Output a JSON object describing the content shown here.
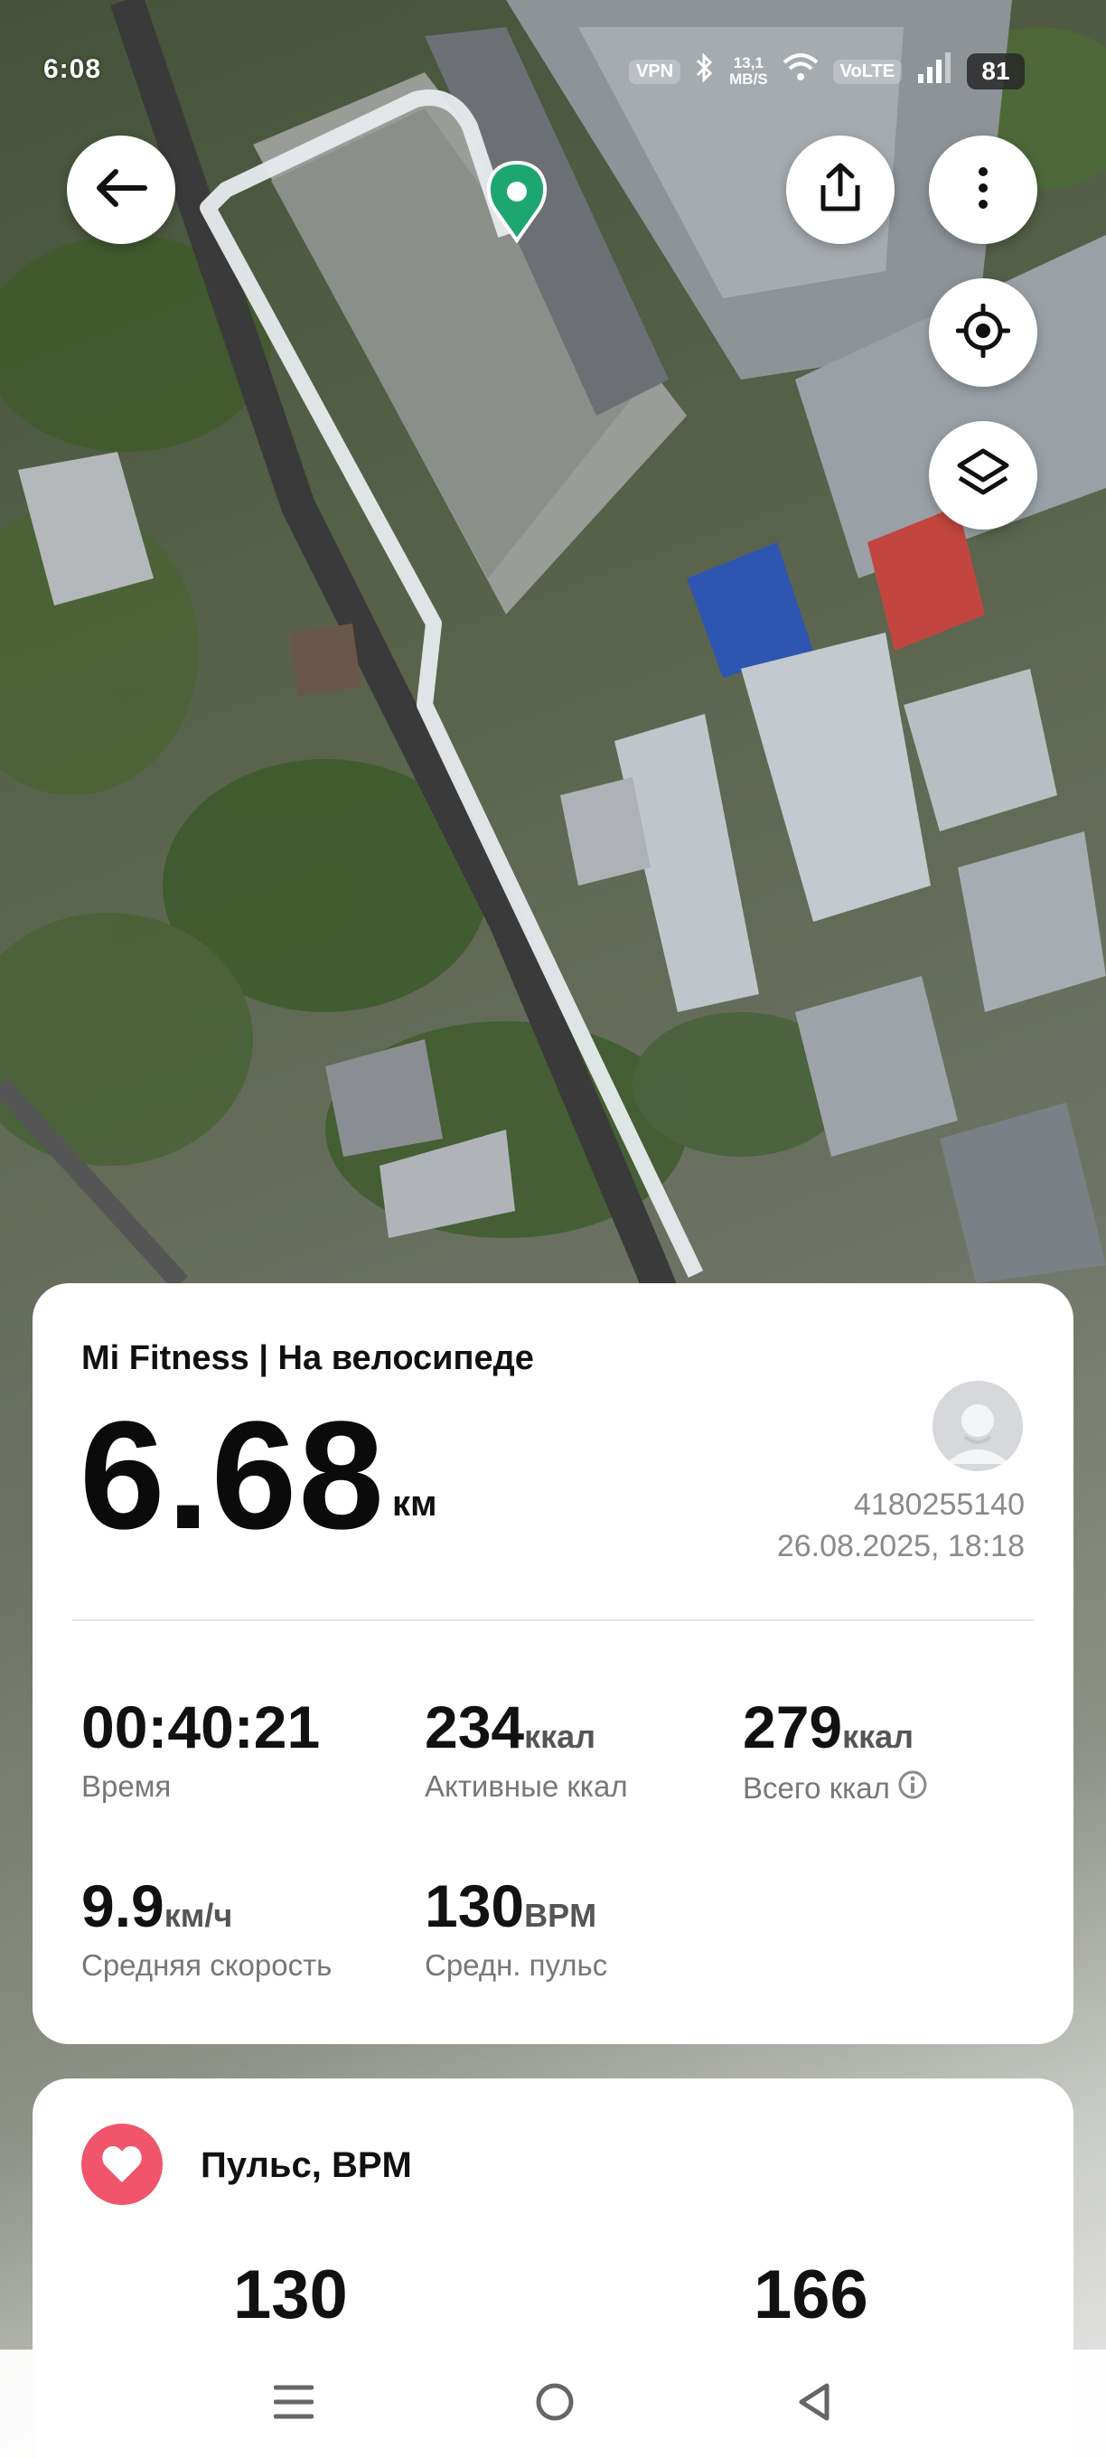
{
  "status_bar": {
    "time": "6:08",
    "vpn": "VPN",
    "net_speed_value": "13,1",
    "net_speed_unit": "MB/S",
    "volte": "VoLTE",
    "battery": "81"
  },
  "map": {
    "back_icon": "arrow-left-icon",
    "share_icon": "share-icon",
    "more_icon": "more-vertical-icon",
    "locate_icon": "crosshair-icon",
    "layers_icon": "layers-icon",
    "pin_color": "#1ea672",
    "route_color": "#e8ebee"
  },
  "summary": {
    "title": "Mi Fitness | На велосипеде",
    "distance": "6.68",
    "distance_unit": "км",
    "user_id": "4180255140",
    "datetime": "26.08.2025, 18:18",
    "stats": {
      "time": {
        "value": "00:40:21",
        "label": "Время"
      },
      "active_kcal": {
        "value": "234",
        "unit": "ккал",
        "label": "Активные ккал"
      },
      "total_kcal": {
        "value": "279",
        "unit": "ккал",
        "label": "Всего ккал"
      },
      "avg_speed": {
        "value": "9.9",
        "unit": "км/ч",
        "label": "Средняя скорость"
      },
      "avg_pulse": {
        "value": "130",
        "unit": "BPM",
        "label": "Средн. пульс"
      }
    }
  },
  "pulse": {
    "title": "Пульс, BPM",
    "accent": "#f0556c",
    "avg": "130",
    "max": "166"
  },
  "navbar": {
    "menu_icon": "menu-icon",
    "home_icon": "home-circle-icon",
    "back_icon": "back-triangle-icon"
  }
}
